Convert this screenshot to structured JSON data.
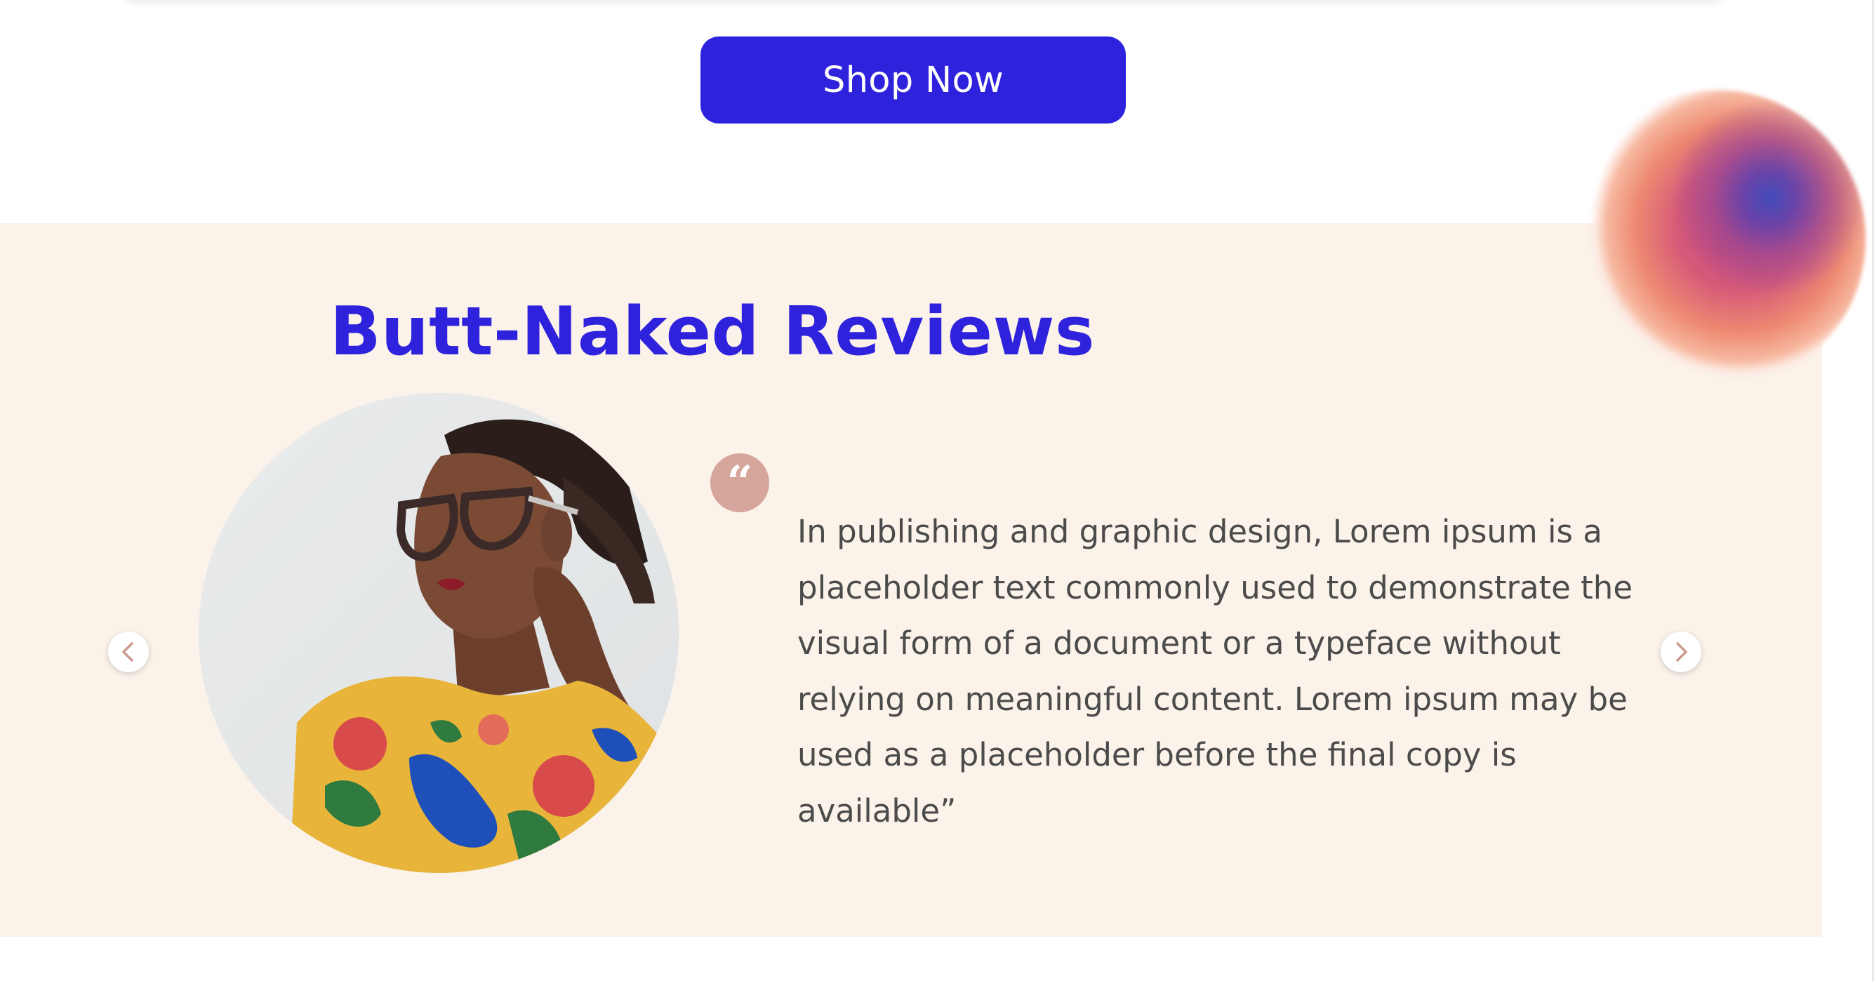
{
  "hero": {
    "cta_label": "Shop Now"
  },
  "reviews": {
    "title": "Butt-Naked Reviews",
    "quote_icon": "quote-icon",
    "items": [
      {
        "text": "In publishing and graphic design, Lorem ipsum is a placeholder text commonly used to demonstrate the visual form of a document or a typeface without relying on meaningful content. Lorem ipsum may be used as a placeholder before the final copy is available”"
      }
    ],
    "prev_icon": "chevron-left-icon",
    "next_icon": "chevron-right-icon"
  },
  "colors": {
    "accent": "#2e22dc",
    "section_background": "#fbf2ea",
    "quote_badge": "#d6a69c",
    "body_text": "#4b4b4b"
  }
}
